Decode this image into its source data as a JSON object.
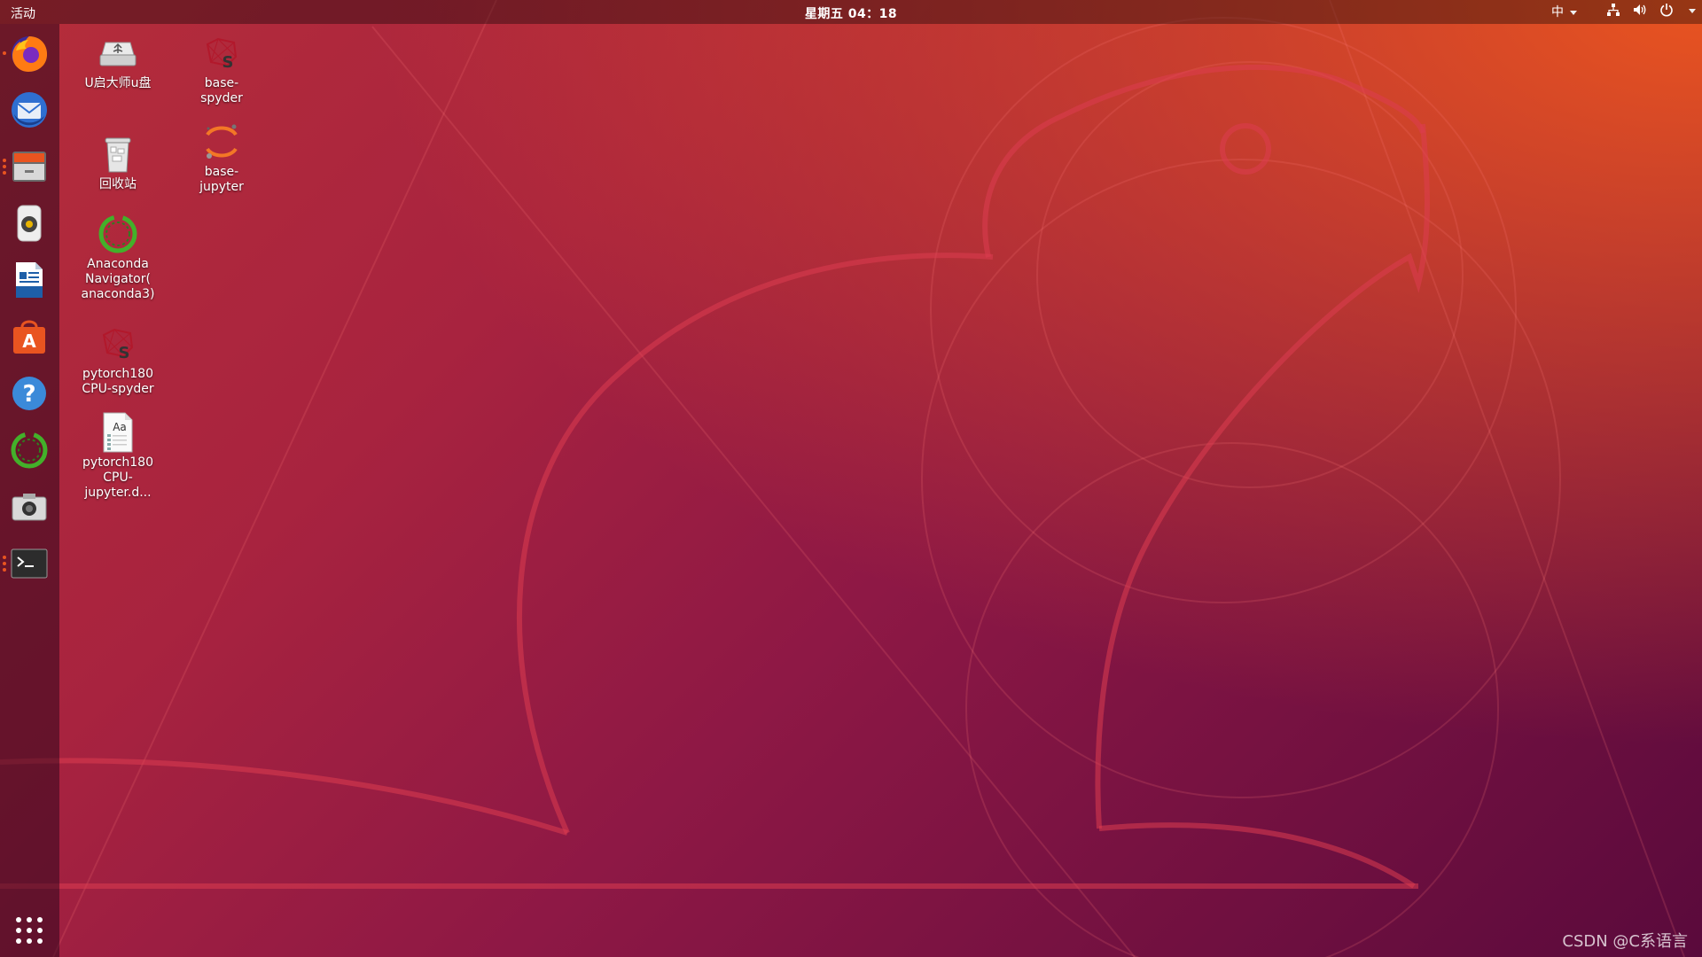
{
  "topbar": {
    "activities": "活动",
    "clock": "星期五 04：18",
    "input_method": "中"
  },
  "dock": {
    "items": [
      {
        "name": "firefox",
        "running": true
      },
      {
        "name": "thunderbird",
        "running": false
      },
      {
        "name": "files",
        "running": true
      },
      {
        "name": "rhythmbox",
        "running": false
      },
      {
        "name": "libreoffice-writer",
        "running": false
      },
      {
        "name": "ubuntu-software",
        "running": false
      },
      {
        "name": "help",
        "running": false
      },
      {
        "name": "anaconda-navigator",
        "running": false
      },
      {
        "name": "screenshot",
        "running": false
      },
      {
        "name": "terminal",
        "running": true
      }
    ],
    "show_apps_icon": "app-grid-icon"
  },
  "desktop": {
    "icons": [
      {
        "label": "U启大师u盘",
        "icon": "usb-drive-icon"
      },
      {
        "label": "base-\nspyder",
        "icon": "spyder-icon"
      },
      {
        "label": "回收站",
        "icon": "trash-icon"
      },
      {
        "label": "base-\njupyter",
        "icon": "jupyter-icon"
      },
      {
        "label": "Anaconda\nNavigator(\nanaconda3)",
        "icon": "anaconda-icon"
      },
      {
        "label": "pytorch180\nCPU-spyder",
        "icon": "spyder-icon"
      },
      {
        "label": "pytorch180\nCPU-\njupyter.d...",
        "icon": "font-document-icon"
      }
    ]
  },
  "watermark": "CSDN @C系语言",
  "colors": {
    "ubuntu_orange": "#e95420",
    "aubergine": "#5a0a3c"
  }
}
